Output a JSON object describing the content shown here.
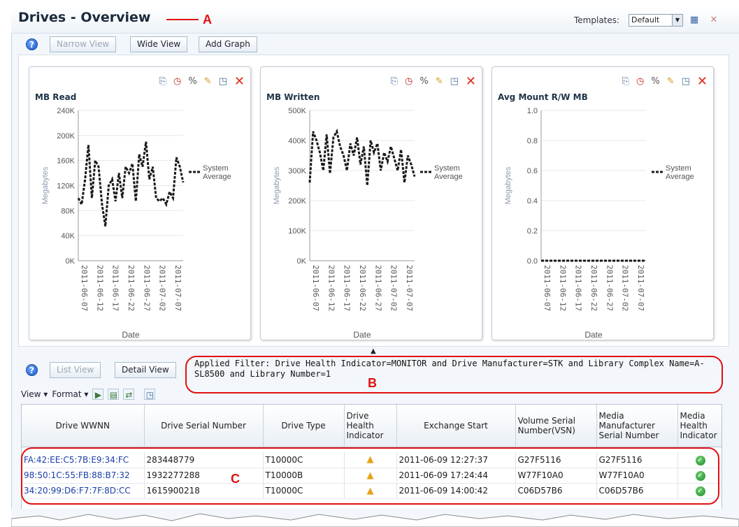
{
  "header": {
    "title": "Drives - Overview",
    "annotation_a": "A",
    "templates_label": "Templates:",
    "templates_value": "Default"
  },
  "graph_toolbar": {
    "narrow_view": "Narrow View",
    "wide_view": "Wide View",
    "add_graph": "Add Graph"
  },
  "graphs": [
    {
      "title": "MB Read",
      "ylabel": "Megabytes",
      "xlabel": "Date",
      "legend": [
        "System",
        "Average"
      ],
      "y_ticks": [
        "240K",
        "200K",
        "160K",
        "120K",
        "80K",
        "40K",
        "0K"
      ],
      "x_ticks": [
        "2011-06-07",
        "2011-06-12",
        "2011-06-17",
        "2011-06-22",
        "2011-06-27",
        "2011-07-02",
        "2011-07-07"
      ]
    },
    {
      "title": "MB Written",
      "ylabel": "Megabytes",
      "xlabel": "Date",
      "legend": [
        "System",
        "Average"
      ],
      "y_ticks": [
        "500K",
        "400K",
        "300K",
        "200K",
        "100K",
        "0K"
      ],
      "x_ticks": [
        "2011-06-07",
        "2011-06-12",
        "2011-06-17",
        "2011-06-22",
        "2011-06-27",
        "2011-07-02",
        "2011-07-07"
      ]
    },
    {
      "title": "Avg Mount R/W MB",
      "ylabel": "Megabytes",
      "xlabel": "Date",
      "legend": [
        "System",
        "Average"
      ],
      "y_ticks": [
        "1.0",
        "0.8",
        "0.6",
        "0.4",
        "0.2",
        "0.0"
      ],
      "x_ticks": [
        "2011-06-07",
        "2011-06-12",
        "2011-06-17",
        "2011-06-22",
        "2011-06-27",
        "2011-07-02",
        "2011-07-07"
      ]
    }
  ],
  "chart_data": [
    {
      "type": "line",
      "title": "MB Read",
      "xlabel": "Date",
      "ylabel": "Megabytes",
      "ylim": [
        0,
        240000
      ],
      "x": [
        "2011-06-07",
        "2011-06-08",
        "2011-06-09",
        "2011-06-10",
        "2011-06-11",
        "2011-06-12",
        "2011-06-13",
        "2011-06-14",
        "2011-06-15",
        "2011-06-16",
        "2011-06-17",
        "2011-06-18",
        "2011-06-19",
        "2011-06-20",
        "2011-06-21",
        "2011-06-22",
        "2011-06-23",
        "2011-06-24",
        "2011-06-25",
        "2011-06-26",
        "2011-06-27",
        "2011-06-28",
        "2011-06-29",
        "2011-06-30",
        "2011-07-01",
        "2011-07-02",
        "2011-07-03",
        "2011-07-04",
        "2011-07-05",
        "2011-07-06",
        "2011-07-07",
        "2011-07-08"
      ],
      "series": [
        {
          "name": "System Average",
          "values": [
            100000,
            90000,
            130000,
            185000,
            100000,
            160000,
            150000,
            90000,
            55000,
            120000,
            130000,
            95000,
            140000,
            100000,
            150000,
            140000,
            155000,
            95000,
            170000,
            150000,
            190000,
            130000,
            150000,
            100000,
            95000,
            100000,
            90000,
            110000,
            100000,
            165000,
            150000,
            125000
          ]
        }
      ],
      "legend": "right",
      "grid": true
    },
    {
      "type": "line",
      "title": "MB Written",
      "xlabel": "Date",
      "ylabel": "Megabytes",
      "ylim": [
        0,
        500000
      ],
      "x": [
        "2011-06-07",
        "2011-06-08",
        "2011-06-09",
        "2011-06-10",
        "2011-06-11",
        "2011-06-12",
        "2011-06-13",
        "2011-06-14",
        "2011-06-15",
        "2011-06-16",
        "2011-06-17",
        "2011-06-18",
        "2011-06-19",
        "2011-06-20",
        "2011-06-21",
        "2011-06-22",
        "2011-06-23",
        "2011-06-24",
        "2011-06-25",
        "2011-06-26",
        "2011-06-27",
        "2011-06-28",
        "2011-06-29",
        "2011-06-30",
        "2011-07-01",
        "2011-07-02",
        "2011-07-03",
        "2011-07-04",
        "2011-07-05",
        "2011-07-06",
        "2011-07-07",
        "2011-07-08"
      ],
      "series": [
        {
          "name": "System Average",
          "values": [
            260000,
            430000,
            400000,
            360000,
            300000,
            420000,
            290000,
            410000,
            430000,
            380000,
            350000,
            300000,
            390000,
            350000,
            410000,
            320000,
            380000,
            250000,
            400000,
            360000,
            390000,
            300000,
            360000,
            330000,
            380000,
            340000,
            300000,
            370000,
            260000,
            350000,
            320000,
            280000
          ]
        }
      ],
      "legend": "right",
      "grid": true
    },
    {
      "type": "line",
      "title": "Avg Mount R/W MB",
      "xlabel": "Date",
      "ylabel": "Megabytes",
      "ylim": [
        0,
        1.0
      ],
      "x": [
        "2011-06-07",
        "2011-07-08"
      ],
      "series": [
        {
          "name": "System Average",
          "values": [
            0.0,
            0.0
          ]
        }
      ],
      "legend": "right",
      "grid": true
    }
  ],
  "report_toolbar": {
    "list_view": "List View",
    "detail_view": "Detail View",
    "view_menu": "View ▾",
    "format_menu": "Format ▾",
    "applied_filter": "Applied Filter: Drive Health Indicator=MONITOR and Drive Manufacturer=STK and Library Complex Name=A-SL8500 and Library Number=1",
    "annotation_b": "B",
    "annotation_c": "C"
  },
  "table": {
    "headers": [
      "Drive WWNN",
      "Drive Serial Number",
      "Drive Type",
      "Drive Health Indicator",
      "Exchange Start",
      "Volume Serial Number(VSN)",
      "Media Manufacturer Serial Number",
      "Media Health Indicator"
    ],
    "rows": [
      [
        "FA:42:EE:C5:7B:E9:34:FC",
        "283448779",
        "T10000C",
        "warning-icon",
        "2011-06-09 12:27:37",
        "G27F5116",
        "G27F5116",
        "ok-icon"
      ],
      [
        "98:50:1C:55:FB:88:B7:32",
        "1932277288",
        "T10000B",
        "warning-icon",
        "2011-06-09 17:24:44",
        "W77F10A0",
        "W77F10A0",
        "ok-icon"
      ],
      [
        "34:20:99:D6:F7:7F:8D:CC",
        "1615900218",
        "T10000C",
        "warning-icon",
        "2011-06-09 14:00:42",
        "C06D57B6",
        "C06D57B6",
        "ok-icon"
      ]
    ]
  },
  "colors": {
    "annotation": "#e01010",
    "link": "#1a3ea8",
    "warning": "#e8a21a",
    "ok": "#1e8a2e"
  }
}
